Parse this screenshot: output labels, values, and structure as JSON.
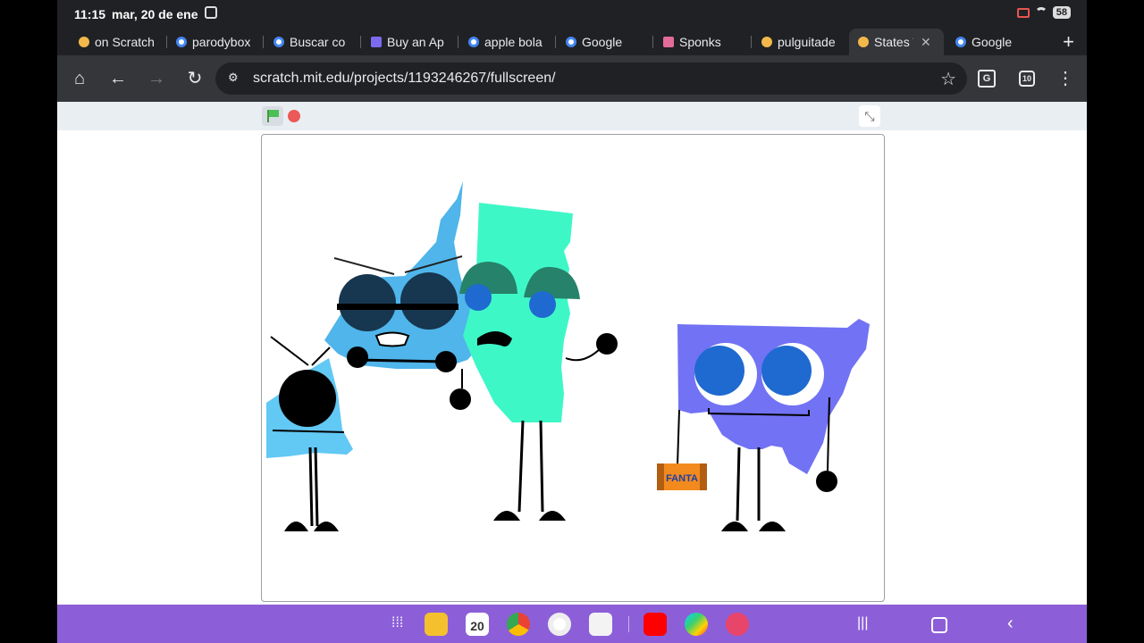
{
  "status_bar": {
    "time": "11:15",
    "date": "mar, 20 de ene",
    "battery": "58"
  },
  "tabs": [
    {
      "label": "on Scratch",
      "favicon": "scratch-icon",
      "color": "#f2b84b"
    },
    {
      "label": "parodybox",
      "favicon": "google-icon",
      "color": "#4285f4"
    },
    {
      "label": "Buscar co",
      "favicon": "google-icon",
      "color": "#4285f4"
    },
    {
      "label": "Buy an Ap",
      "favicon": "dots-icon",
      "color": "#7c6bf0"
    },
    {
      "label": "apple bola",
      "favicon": "google-icon",
      "color": "#4285f4"
    },
    {
      "label": "Google",
      "favicon": "google-icon",
      "color": "#4285f4"
    },
    {
      "label": "Sponks",
      "favicon": "grid-icon",
      "color": "#e36b9a"
    },
    {
      "label": "pulguitade",
      "favicon": "scratch-icon",
      "color": "#f2b84b"
    },
    {
      "label": "States T",
      "favicon": "scratch-icon",
      "color": "#f2b84b",
      "active": true
    },
    {
      "label": "Google",
      "favicon": "google-icon",
      "color": "#4285f4"
    }
  ],
  "toolbar": {
    "url": "scratch.mit.edu/projects/1193246267/fullscreen/",
    "tab_count": "10",
    "translate_label": "G"
  },
  "nav": {
    "calendar_month": "MAR",
    "calendar_day": "20"
  },
  "stage": {
    "can_label": "FANTA"
  },
  "colors": {
    "nav_bar": "#8c5fd8",
    "chrome_dark": "#202124",
    "chrome_toolbar": "#35363a",
    "scratch_bar": "#e9eef2"
  }
}
